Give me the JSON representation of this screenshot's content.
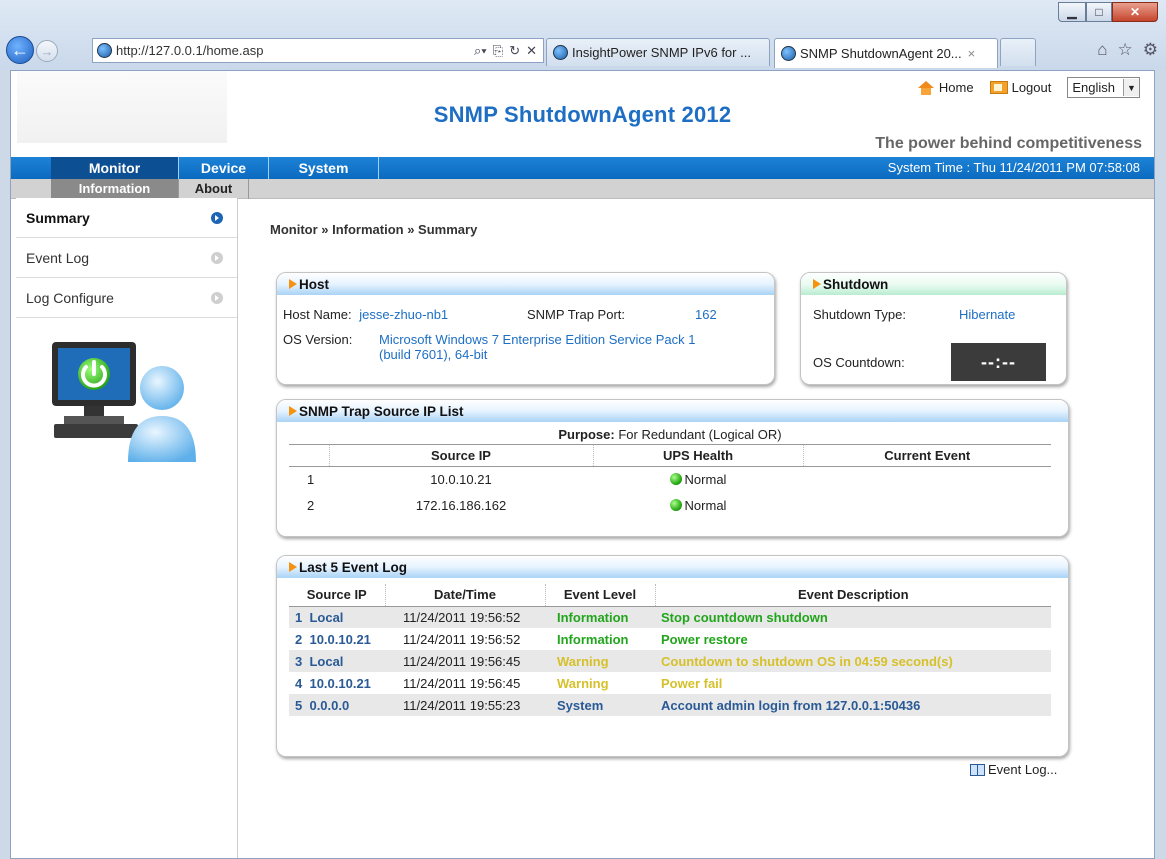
{
  "browser": {
    "url": "http://127.0.0.1/home.asp",
    "tabs": [
      {
        "label": "InsightPower SNMP IPv6 for ..."
      },
      {
        "label": "SNMP ShutdownAgent 20...",
        "close": "×"
      }
    ]
  },
  "header": {
    "home_label": "Home",
    "logout_label": "Logout",
    "language": "English",
    "title": "SNMP ShutdownAgent 2012",
    "tagline": "The power behind competitiveness"
  },
  "menu": {
    "items": [
      "Monitor",
      "Device",
      "System"
    ],
    "system_time": "System Time : Thu 11/24/2011 PM 07:58:08"
  },
  "submenu": {
    "items": [
      "Information",
      "About"
    ]
  },
  "sidebar": {
    "items": [
      "Summary",
      "Event Log",
      "Log Configure"
    ]
  },
  "breadcrumb": "Monitor » Information » Summary",
  "host": {
    "title": "Host",
    "host_name_label": "Host Name:",
    "host_name": "jesse-zhuo-nb1",
    "trap_port_label": "SNMP Trap Port:",
    "trap_port": "162",
    "os_version_label": "OS Version:",
    "os_version_line1": "Microsoft Windows 7 Enterprise Edition Service Pack 1",
    "os_version_line2": "(build 7601), 64-bit"
  },
  "shutdown": {
    "title": "Shutdown",
    "type_label": "Shutdown Type:",
    "type": "Hibernate",
    "countdown_label": "OS Countdown:",
    "countdown": "--:--"
  },
  "trap_list": {
    "title": "SNMP Trap Source IP List",
    "purpose_label": "Purpose:",
    "purpose": "For Redundant (Logical OR)",
    "columns": [
      "Source IP",
      "UPS Health",
      "Current Event"
    ],
    "rows": [
      {
        "index": "1",
        "ip": "10.0.10.21",
        "health": "Normal",
        "event": ""
      },
      {
        "index": "2",
        "ip": "172.16.186.162",
        "health": "Normal",
        "event": ""
      }
    ]
  },
  "event_log": {
    "title": "Last 5 Event Log",
    "columns": [
      "Source IP",
      "Date/Time",
      "Event Level",
      "Event Description"
    ],
    "rows": [
      {
        "index": "1",
        "source": "Local",
        "datetime": "11/24/2011 19:56:52",
        "level": "Information",
        "description": "Stop countdown shutdown"
      },
      {
        "index": "2",
        "source": "10.0.10.21",
        "datetime": "11/24/2011 19:56:52",
        "level": "Information",
        "description": "Power restore"
      },
      {
        "index": "3",
        "source": "Local",
        "datetime": "11/24/2011 19:56:45",
        "level": "Warning",
        "description": "Countdown to shutdown OS in 04:59 second(s)"
      },
      {
        "index": "4",
        "source": "10.0.10.21",
        "datetime": "11/24/2011 19:56:45",
        "level": "Warning",
        "description": "Power fail"
      },
      {
        "index": "5",
        "source": "0.0.0.0",
        "datetime": "11/24/2011 19:55:23",
        "level": "System",
        "description": "Account admin login from 127.0.0.1:50436"
      }
    ],
    "more_link": "Event Log..."
  },
  "colors": {
    "title_blue": "#1e6fc4",
    "menubar_blue": "#0b6abf",
    "info_green": "#22a51c",
    "warning_yellow": "#d6c12a",
    "system_blue": "#2a5a96",
    "accent_orange": "#f5920f"
  }
}
